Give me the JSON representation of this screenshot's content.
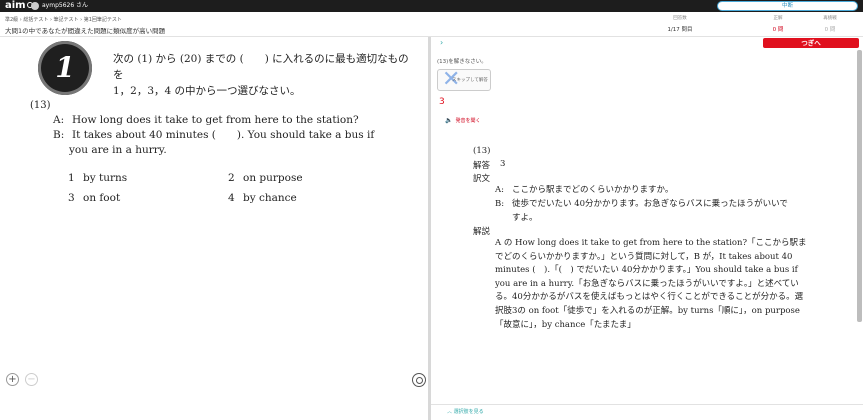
{
  "app": {
    "brand": "aim",
    "user_name": "aymp5626 さん"
  },
  "topbar": {
    "stop_label": "中断"
  },
  "breadcrumb": "準2級 › 総括テスト › 筆記テスト › 第1回筆記テスト",
  "page_title": "大問1の中であなたが間違えた問題に類似度が高い問題",
  "stats": [
    {
      "label": "回答数",
      "value": "1/17 問目",
      "tone": "normal"
    },
    {
      "label": "正解",
      "value": "0 問",
      "tone": "red"
    },
    {
      "label": "再挑戦",
      "value": "0 問",
      "tone": "gray"
    }
  ],
  "question": {
    "badge": "1",
    "instruction_line1": "次の (1) から (20) までの (　　) に入れるのに最も適切なものを",
    "instruction_line2": "1，2，3，4 の中から一つ選びなさい。",
    "number": "(13)",
    "dialog": [
      {
        "speaker": "A:",
        "line1": "How long does it take to get from here to the station?",
        "line2": ""
      },
      {
        "speaker": "B:",
        "line1": "It takes about 40 minutes (　　).  You should take a bus if",
        "line2": "you are in a hurry."
      }
    ],
    "options": [
      {
        "num": "1",
        "text": "by turns"
      },
      {
        "num": "2",
        "text": "on purpose"
      },
      {
        "num": "3",
        "text": "on foot"
      },
      {
        "num": "4",
        "text": "by chance"
      }
    ]
  },
  "controls": {
    "zoom_in": "+",
    "zoom_out": "−"
  },
  "right": {
    "next_label": "つぎへ",
    "solve_prompt": "(13)を解きなさい。",
    "skip_label": "スキップして解答",
    "answer_value": "3",
    "audio_label": "発音を聞く",
    "explanation": {
      "number": "(13)",
      "answer_head": "解答",
      "answer": "3",
      "translation_head": "訳文",
      "tr_a_speaker": "A:",
      "tr_a": "ここから駅までどのくらいかかりますか。",
      "tr_b_speaker": "B:",
      "tr_b1": "徒歩でだいたい 40分かかります。お急ぎならバスに乗ったほうがいいで",
      "tr_b2": "すよ。",
      "commentary_head": "解説",
      "commentary": "A の How long does it take to get from here to the station?「ここから駅までどのくらいかかりますか。」という質問に対して，B が，It takes about 40 minutes (　).「(　) でだいたい 40分かかります。」You should take a bus if you are in a hurry.「お急ぎならバスに乗ったほうがいいですよ。」と述べている。40分かかるがバスを使えばもっとはやく行くことができることが分かる。選択肢3の on foot「徒歩で」を入れるのが正解。by turns「順に」，on purpose「故意に」，by chance「たまたま」"
    },
    "bottom_link": "選択肢を見る"
  }
}
